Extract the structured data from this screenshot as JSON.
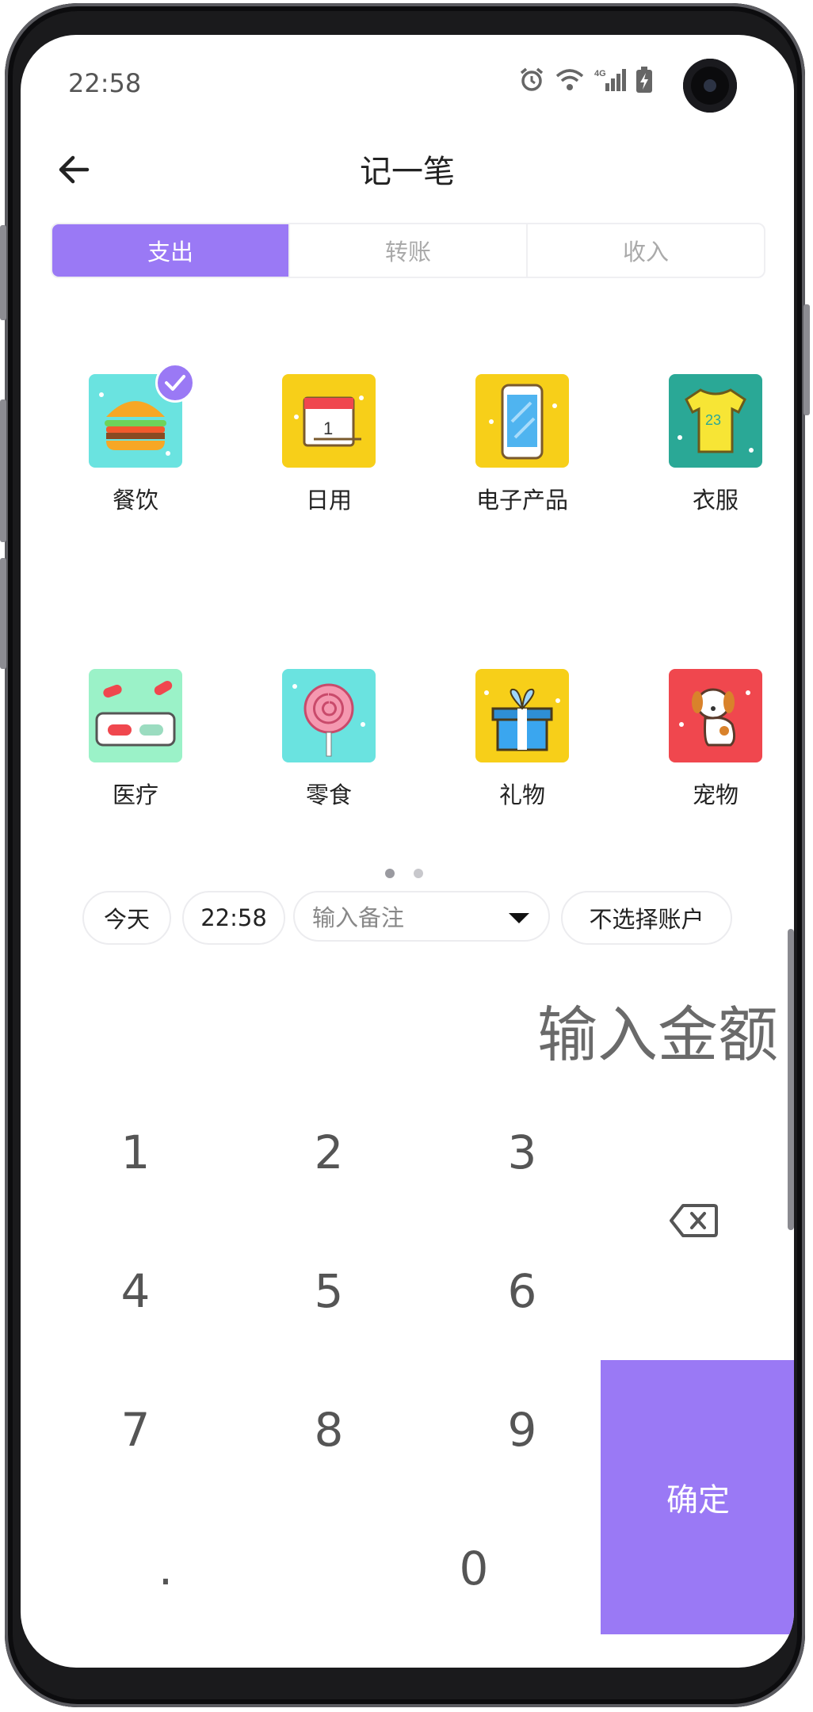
{
  "status_bar": {
    "time": "22:58",
    "icons": [
      "alarm-icon",
      "wifi-icon",
      "signal-4g-icon",
      "battery-icon"
    ]
  },
  "header": {
    "title": "记一笔",
    "back_icon": "arrow-left-icon"
  },
  "tabs": [
    {
      "label": "支出",
      "selected": true
    },
    {
      "label": "转账",
      "selected": false
    },
    {
      "label": "收入",
      "selected": false
    }
  ],
  "categories": [
    {
      "label": "餐饮",
      "icon": "burger-icon",
      "color": "#6ae3e0",
      "selected": true
    },
    {
      "label": "日用",
      "icon": "calendar-icon",
      "color": "#f7cf19"
    },
    {
      "label": "电子产品",
      "icon": "phone-icon",
      "color": "#f7cf19"
    },
    {
      "label": "衣服",
      "icon": "tshirt-icon",
      "color": "#2aa896"
    },
    {
      "label": "医疗",
      "icon": "pills-icon",
      "color": "#9bf2c8"
    },
    {
      "label": "零食",
      "icon": "lollipop-icon",
      "color": "#6ae3e0"
    },
    {
      "label": "礼物",
      "icon": "gift-icon",
      "color": "#f7cf19"
    },
    {
      "label": "宠物",
      "icon": "dog-icon",
      "color": "#f0474e"
    }
  ],
  "pager": {
    "pages": 2,
    "current": 1
  },
  "entry": {
    "date": "今天",
    "time": "22:58",
    "note_placeholder": "输入备注",
    "account": "不选择账户"
  },
  "amount_placeholder": "输入金额",
  "keypad": {
    "keys": [
      "1",
      "2",
      "3",
      "4",
      "5",
      "6",
      "7",
      "8",
      "9",
      ".",
      "0"
    ],
    "confirm_label": "确定",
    "delete_icon": "backspace-icon"
  },
  "colors": {
    "accent": "#9a79f5"
  }
}
